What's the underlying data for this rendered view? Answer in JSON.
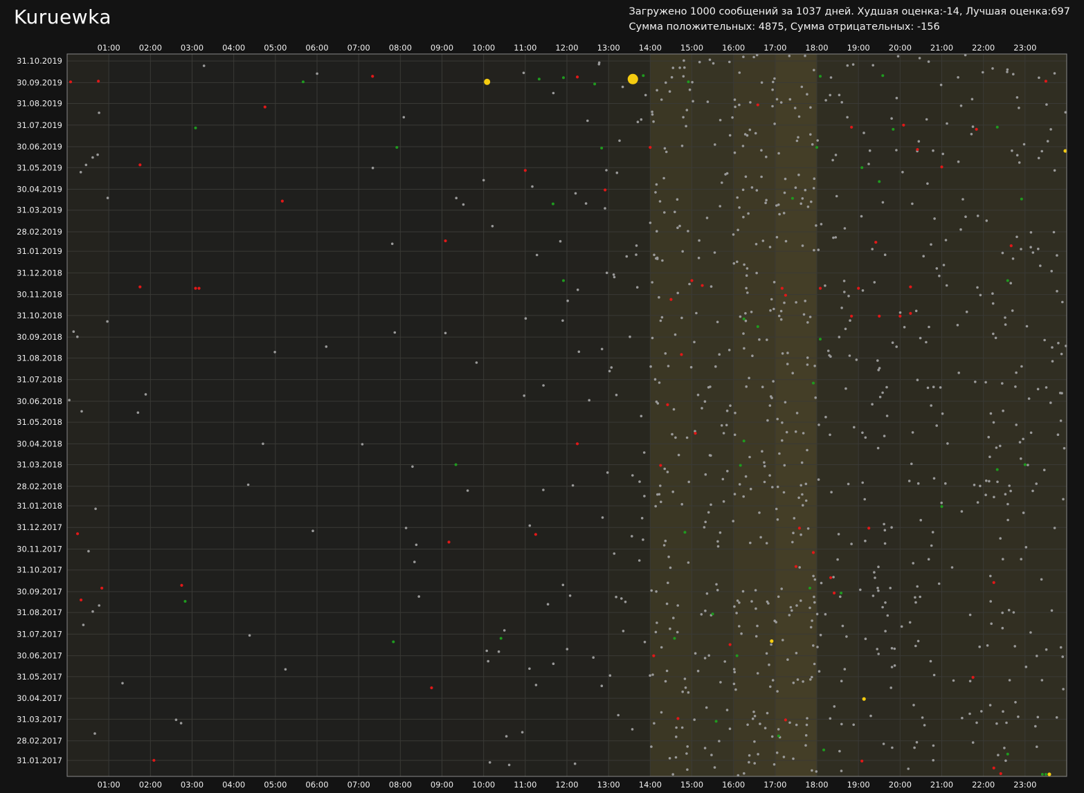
{
  "window": {
    "title": "Kuruewka"
  },
  "summary": {
    "line1": "Загружено 1000 сообщений за 1037 дней. Худшая оценка:-14, Лучшая оценка:697",
    "line2": "Сумма положительных: 4875, Сумма отрицательных: -156"
  },
  "colors": {
    "background": "#131313",
    "plot": "#1f1f1d",
    "neutral": "#9a9a9a",
    "positive": "#1f9a1f",
    "negative": "#e01818",
    "highlight": "#f5cc10"
  },
  "chart_data": {
    "type": "scatter",
    "title": "",
    "x_label": "",
    "y_label": "",
    "x_ticks": [
      "01:00",
      "02:00",
      "03:00",
      "04:00",
      "05:00",
      "06:00",
      "07:00",
      "08:00",
      "09:00",
      "10:00",
      "11:00",
      "12:00",
      "13:00",
      "14:00",
      "15:00",
      "16:00",
      "17:00",
      "18:00",
      "19:00",
      "20:00",
      "21:00",
      "22:00",
      "23:00"
    ],
    "y_ticks": [
      "31.10.2019",
      "30.09.2019",
      "31.08.2019",
      "31.07.2019",
      "30.06.2019",
      "31.05.2019",
      "30.04.2019",
      "31.03.2019",
      "28.02.2019",
      "31.01.2019",
      "31.12.2018",
      "30.11.2018",
      "31.10.2018",
      "30.09.2018",
      "31.08.2018",
      "31.07.2018",
      "30.06.2018",
      "31.05.2018",
      "30.04.2018",
      "31.03.2018",
      "28.02.2018",
      "31.01.2018",
      "31.12.2017",
      "30.11.2017",
      "31.10.2017",
      "30.09.2017",
      "31.08.2017",
      "31.07.2017",
      "30.06.2017",
      "31.05.2017",
      "30.04.2017",
      "31.03.2017",
      "28.02.2017",
      "31.01.2017"
    ],
    "x_range_hours": [
      0,
      24
    ],
    "y_range": [
      "2017-01-08",
      "2019-11-10"
    ],
    "grid": true,
    "activity_bands": [
      {
        "hours": [
          0,
          1
        ],
        "level": 0.12
      },
      {
        "hours": [
          1,
          9
        ],
        "level": 0.0
      },
      {
        "hours": [
          9,
          10
        ],
        "level": 0.05
      },
      {
        "hours": [
          10,
          11
        ],
        "level": 0.1
      },
      {
        "hours": [
          11,
          12
        ],
        "level": 0.06
      },
      {
        "hours": [
          12,
          13
        ],
        "level": 0.1
      },
      {
        "hours": [
          13,
          14
        ],
        "level": 0.22
      },
      {
        "hours": [
          14,
          15
        ],
        "level": 0.62
      },
      {
        "hours": [
          15,
          16
        ],
        "level": 0.56
      },
      {
        "hours": [
          16,
          17
        ],
        "level": 0.7
      },
      {
        "hours": [
          17,
          18
        ],
        "level": 0.82
      },
      {
        "hours": [
          18,
          19
        ],
        "level": 0.4
      },
      {
        "hours": [
          19,
          20
        ],
        "level": 0.32
      },
      {
        "hours": [
          20,
          21
        ],
        "level": 0.34
      },
      {
        "hours": [
          21,
          22
        ],
        "level": 0.36
      },
      {
        "hours": [
          22,
          23
        ],
        "level": 0.44
      },
      {
        "hours": [
          23,
          24
        ],
        "level": 0.4
      }
    ],
    "highlight_points": [
      {
        "time": "10:05",
        "date": "2019-10-01",
        "size": "medium"
      },
      {
        "time": "13:35",
        "date": "2019-10-05",
        "size": "large"
      },
      {
        "time": "16:55",
        "date": "2017-07-21",
        "size": "small"
      },
      {
        "time": "19:08",
        "date": "2017-04-29",
        "size": "small"
      },
      {
        "time": "23:35",
        "date": "2017-01-11",
        "size": "small"
      },
      {
        "time": "23:58",
        "date": "2019-06-24",
        "size": "small"
      }
    ],
    "negative_points": [
      {
        "time": "00:05",
        "date": "2019-10-01"
      },
      {
        "time": "00:45",
        "date": "2019-10-02"
      },
      {
        "time": "07:20",
        "date": "2019-10-09"
      },
      {
        "time": "12:15",
        "date": "2019-10-08"
      },
      {
        "time": "04:45",
        "date": "2019-08-26"
      },
      {
        "time": "01:45",
        "date": "2019-06-04"
      },
      {
        "time": "11:00",
        "date": "2019-05-27"
      },
      {
        "time": "05:10",
        "date": "2019-04-13"
      },
      {
        "time": "09:05",
        "date": "2019-02-15"
      },
      {
        "time": "01:45",
        "date": "2018-12-11"
      },
      {
        "time": "03:05",
        "date": "2018-12-09"
      },
      {
        "time": "03:10",
        "date": "2018-12-09"
      },
      {
        "time": "00:15",
        "date": "2017-12-22"
      },
      {
        "time": "00:50",
        "date": "2017-10-05"
      },
      {
        "time": "00:20",
        "date": "2017-09-18"
      },
      {
        "time": "02:45",
        "date": "2017-10-09"
      },
      {
        "time": "02:05",
        "date": "2017-01-31"
      },
      {
        "time": "09:10",
        "date": "2017-12-10"
      },
      {
        "time": "11:15",
        "date": "2017-12-21"
      },
      {
        "time": "12:15",
        "date": "2018-04-30"
      },
      {
        "time": "08:45",
        "date": "2017-05-15"
      },
      {
        "time": "16:35",
        "date": "2019-08-29"
      },
      {
        "time": "18:50",
        "date": "2019-07-28"
      },
      {
        "time": "20:05",
        "date": "2019-07-31"
      },
      {
        "time": "20:25",
        "date": "2019-06-26"
      },
      {
        "time": "21:00",
        "date": "2019-06-01"
      },
      {
        "time": "21:50",
        "date": "2019-07-25"
      },
      {
        "time": "23:30",
        "date": "2019-10-02"
      },
      {
        "time": "14:00",
        "date": "2019-06-29"
      },
      {
        "time": "12:55",
        "date": "2019-04-29"
      },
      {
        "time": "19:25",
        "date": "2019-02-13"
      },
      {
        "time": "22:40",
        "date": "2019-02-08"
      },
      {
        "time": "15:00",
        "date": "2018-12-20"
      },
      {
        "time": "15:15",
        "date": "2018-12-13"
      },
      {
        "time": "17:10",
        "date": "2018-12-09"
      },
      {
        "time": "18:05",
        "date": "2018-12-09"
      },
      {
        "time": "19:00",
        "date": "2018-12-09"
      },
      {
        "time": "20:15",
        "date": "2018-12-11"
      },
      {
        "time": "17:15",
        "date": "2018-11-29"
      },
      {
        "time": "14:30",
        "date": "2018-11-23"
      },
      {
        "time": "18:50",
        "date": "2018-10-30"
      },
      {
        "time": "19:30",
        "date": "2018-10-30"
      },
      {
        "time": "20:00",
        "date": "2018-10-30"
      },
      {
        "time": "20:15",
        "date": "2018-11-03"
      },
      {
        "time": "14:45",
        "date": "2018-09-05"
      },
      {
        "time": "14:25",
        "date": "2018-06-25"
      },
      {
        "time": "15:05",
        "date": "2018-05-15"
      },
      {
        "time": "14:15",
        "date": "2018-03-30"
      },
      {
        "time": "17:35",
        "date": "2017-12-30"
      },
      {
        "time": "19:15",
        "date": "2017-12-30"
      },
      {
        "time": "17:55",
        "date": "2017-11-25"
      },
      {
        "time": "17:30",
        "date": "2017-11-05"
      },
      {
        "time": "18:20",
        "date": "2017-10-20"
      },
      {
        "time": "18:25",
        "date": "2017-09-28"
      },
      {
        "time": "22:15",
        "date": "2017-10-13"
      },
      {
        "time": "15:55",
        "date": "2017-07-16"
      },
      {
        "time": "14:05",
        "date": "2017-06-30"
      },
      {
        "time": "14:40",
        "date": "2017-04-01"
      },
      {
        "time": "17:15",
        "date": "2017-03-30"
      },
      {
        "time": "21:45",
        "date": "2017-05-30"
      },
      {
        "time": "19:05",
        "date": "2017-01-30"
      },
      {
        "time": "22:15",
        "date": "2017-01-20"
      },
      {
        "time": "22:25",
        "date": "2017-01-12"
      }
    ],
    "positive_points": [
      {
        "time": "05:40",
        "date": "2019-10-01"
      },
      {
        "time": "03:05",
        "date": "2019-07-27"
      },
      {
        "time": "11:20",
        "date": "2019-10-05"
      },
      {
        "time": "11:55",
        "date": "2019-10-07"
      },
      {
        "time": "12:40",
        "date": "2019-09-28"
      },
      {
        "time": "13:50",
        "date": "2019-10-10"
      },
      {
        "time": "14:55",
        "date": "2019-10-01"
      },
      {
        "time": "18:05",
        "date": "2019-10-09"
      },
      {
        "time": "19:35",
        "date": "2019-10-10"
      },
      {
        "time": "07:55",
        "date": "2019-06-29"
      },
      {
        "time": "12:50",
        "date": "2019-06-28"
      },
      {
        "time": "11:40",
        "date": "2019-04-09"
      },
      {
        "time": "17:25",
        "date": "2019-04-17"
      },
      {
        "time": "19:05",
        "date": "2019-05-31"
      },
      {
        "time": "19:30",
        "date": "2019-05-11"
      },
      {
        "time": "18:00",
        "date": "2019-06-29"
      },
      {
        "time": "19:50",
        "date": "2019-07-25"
      },
      {
        "time": "22:20",
        "date": "2019-07-28"
      },
      {
        "time": "22:55",
        "date": "2019-04-16"
      },
      {
        "time": "11:55",
        "date": "2018-12-20"
      },
      {
        "time": "22:35",
        "date": "2018-12-20"
      },
      {
        "time": "16:15",
        "date": "2018-10-26"
      },
      {
        "time": "16:35",
        "date": "2018-10-15"
      },
      {
        "time": "18:05",
        "date": "2018-09-27"
      },
      {
        "time": "17:55",
        "date": "2018-07-26"
      },
      {
        "time": "16:15",
        "date": "2018-05-04"
      },
      {
        "time": "09:20",
        "date": "2018-03-31"
      },
      {
        "time": "16:10",
        "date": "2018-03-30"
      },
      {
        "time": "22:20",
        "date": "2018-03-24"
      },
      {
        "time": "23:00",
        "date": "2018-03-31"
      },
      {
        "time": "21:00",
        "date": "2018-01-30"
      },
      {
        "time": "14:50",
        "date": "2017-12-24"
      },
      {
        "time": "17:50",
        "date": "2017-10-05"
      },
      {
        "time": "18:35",
        "date": "2017-09-28"
      },
      {
        "time": "15:30",
        "date": "2017-08-29"
      },
      {
        "time": "02:50",
        "date": "2017-09-16"
      },
      {
        "time": "07:50",
        "date": "2017-07-20"
      },
      {
        "time": "10:25",
        "date": "2017-07-25"
      },
      {
        "time": "14:35",
        "date": "2017-07-25"
      },
      {
        "time": "16:05",
        "date": "2017-06-30"
      },
      {
        "time": "15:35",
        "date": "2017-03-28"
      },
      {
        "time": "17:05",
        "date": "2017-03-07"
      },
      {
        "time": "18:10",
        "date": "2017-02-15"
      },
      {
        "time": "22:35",
        "date": "2017-02-09"
      },
      {
        "time": "23:25",
        "date": "2017-01-11"
      },
      {
        "time": "23:30",
        "date": "2017-01-11"
      }
    ],
    "neutral_points_count": 894
  }
}
